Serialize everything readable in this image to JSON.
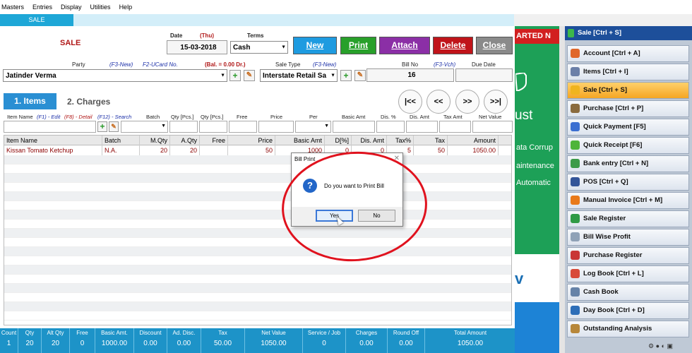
{
  "menu": [
    "Masters",
    "Entries",
    "Display",
    "Utilities",
    "Help"
  ],
  "window_tab": "SALE",
  "form_title": "SALE",
  "date": {
    "label": "Date",
    "day": "(Thu)",
    "value": "15-03-2018"
  },
  "terms": {
    "label": "Terms",
    "value": "Cash"
  },
  "buttons": {
    "new": "New",
    "print": "Print",
    "attach": "Attach",
    "delete": "Delete",
    "close": "Close"
  },
  "colors": {
    "new": "#1e9be0",
    "print": "#28a02a",
    "attach": "#8b2fa6",
    "delete": "#c0141a",
    "close": "#8a8a8a",
    "accent": "#1d93c8"
  },
  "party": {
    "label": "Party",
    "hint1": "(F3-New)",
    "hint2": "F2-UCard No.",
    "balance": "(Bal. = 0.00 Dr.)",
    "value": "Jatinder Verma"
  },
  "sale_type": {
    "label": "Sale Type",
    "hint": "(F3-New)",
    "value": "Interstate Retail Sa"
  },
  "bill_no": {
    "label": "Bill No",
    "hint": "(F3-Vch)",
    "value": "16"
  },
  "due_date": {
    "label": "Due Date",
    "value": ""
  },
  "tabs": {
    "items": "1. Items",
    "charges": "2. Charges"
  },
  "nav": {
    "first": "|<<",
    "prev": "<<",
    "next": ">>",
    "last": ">>|"
  },
  "entry_labels": {
    "item_name": "Item Name",
    "edit": "(F1) - Edit",
    "detail": "(F8) - Detail",
    "search": "(F12) - Search",
    "batch": "Batch",
    "qty": "Qty [Pcs.]",
    "qty2": "Qty [Pcs.]",
    "free": "Free",
    "price": "Price",
    "per": "Per",
    "basic_amt": "Basic Amt",
    "disc_pct": "Dis. %",
    "disc_amt": "Dis. Amt",
    "tax_amt": "Tax Amt",
    "net_value": "Net Value"
  },
  "grid": {
    "headers": [
      "Item Name",
      "Batch",
      "M.Qty",
      "A.Qty",
      "Free",
      "Price",
      "Basic Amt",
      "D[%]",
      "Dis. Amt",
      "Tax%",
      "Tax",
      "Amount"
    ],
    "rows": [
      [
        "Kissan Tomato Ketchup",
        "N.A.",
        "20",
        "20",
        "",
        "50",
        "1000",
        "0",
        "0",
        "5",
        "50",
        "1050.00"
      ]
    ]
  },
  "footer": [
    {
      "h": "Count",
      "v": "1"
    },
    {
      "h": "Qty",
      "v": "20"
    },
    {
      "h": "Alt Qty",
      "v": "20"
    },
    {
      "h": "Free",
      "v": "0"
    },
    {
      "h": "Basic Amt.",
      "v": "1000.00"
    },
    {
      "h": "Discount",
      "v": "0.00"
    },
    {
      "h": "Ad. Disc.",
      "v": "0.00"
    },
    {
      "h": "Tax",
      "v": "50.00"
    },
    {
      "h": "Net Value",
      "v": "1050.00"
    },
    {
      "h": "Service / Job",
      "v": "0"
    },
    {
      "h": "Charges",
      "v": "0.00"
    },
    {
      "h": "Round Off",
      "v": "0.00"
    },
    {
      "h": "Total Amount",
      "v": "1050.00"
    }
  ],
  "background_panel": {
    "banner": "ARTED N",
    "t1": "ust",
    "t2": "ata Corrup",
    "t3": "aintenance",
    "t4": "Automatic",
    "t5": "v"
  },
  "sidebar": {
    "header": "Sale [Ctrl + S]",
    "items": [
      {
        "label": "Account [Ctrl + A]",
        "icon": "account-icon",
        "color": "#e0672a"
      },
      {
        "label": "Items [Ctrl + I]",
        "icon": "items-icon",
        "color": "#6b7fa8"
      },
      {
        "label": "Sale [Ctrl + S]",
        "icon": "sale-icon",
        "color": "#f0b41e",
        "active": true
      },
      {
        "label": "Purchase [Ctrl + P]",
        "icon": "purchase-icon",
        "color": "#8a6b3e"
      },
      {
        "label": "Quick Payment [F5]",
        "icon": "quick-payment-icon",
        "color": "#3b6fd1"
      },
      {
        "label": "Quick Receipt [F6]",
        "icon": "quick-receipt-icon",
        "color": "#4eb43a"
      },
      {
        "label": "Bank entry [Ctrl + N]",
        "icon": "bank-icon",
        "color": "#3c9b48"
      },
      {
        "label": "POS [Ctrl + Q]",
        "icon": "pos-icon",
        "color": "#335599"
      },
      {
        "label": "Manual Invoice [Ctrl + M]",
        "icon": "manual-invoice-icon",
        "color": "#e97a1a"
      },
      {
        "label": "Sale Register",
        "icon": "sale-register-icon",
        "color": "#2f9a45"
      },
      {
        "label": "Bill Wise Profit",
        "icon": "bill-profit-icon",
        "color": "#8fa2b7"
      },
      {
        "label": "Purchase Register",
        "icon": "purchase-register-icon",
        "color": "#c93636"
      },
      {
        "label": "Log Book [Ctrl + L]",
        "icon": "log-book-icon",
        "color": "#d84a3a"
      },
      {
        "label": "Cash Book",
        "icon": "cash-book-icon",
        "color": "#6683a8"
      },
      {
        "label": "Day Book [Ctrl + D]",
        "icon": "day-book-icon",
        "color": "#2d6eb8"
      },
      {
        "label": "Outstanding Analysis",
        "icon": "outstanding-icon",
        "color": "#b7873a"
      }
    ]
  },
  "dialog": {
    "title": "Bill Print",
    "message": "Do you want to Print Bill",
    "yes": "Yes",
    "no": "No"
  }
}
